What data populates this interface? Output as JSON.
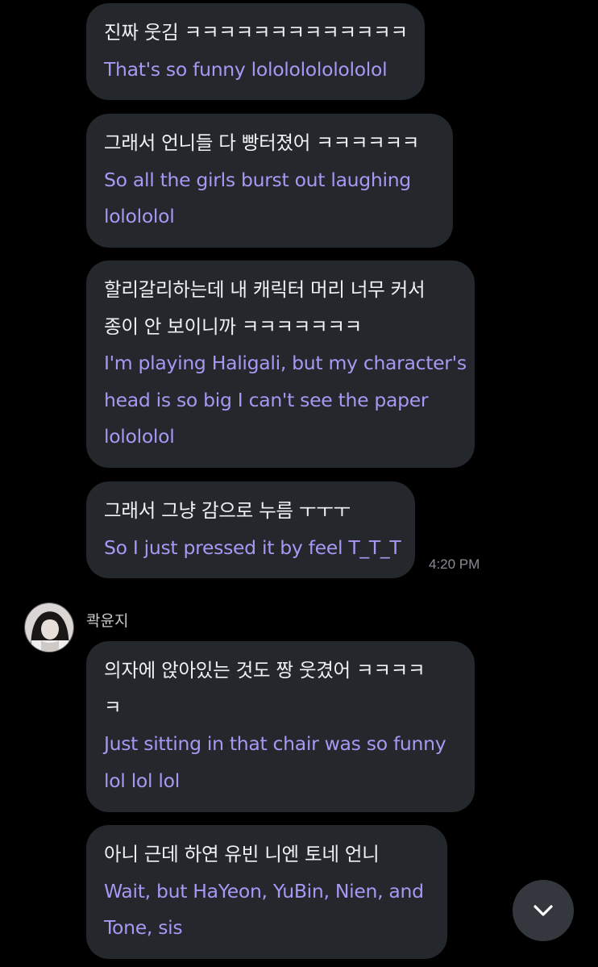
{
  "messages": [
    {
      "ko": [
        "진짜 웃김 ㅋㅋㅋㅋㅋㅋㅋㅋㅋㅋㅋㅋㅋ"
      ],
      "en": [
        "That's so funny lolololololololol"
      ]
    },
    {
      "ko": [
        "그래서 언니들 다 빵터졌어 ㅋㅋㅋㅋㅋㅋ"
      ],
      "en": [
        "So all the girls burst out laughing",
        "lolololol"
      ]
    },
    {
      "ko": [
        "할리갈리하는데 내 캐릭터 머리 너무 커서",
        "종이 안 보이니까 ㅋㅋㅋㅋㅋㅋㅋ"
      ],
      "en": [
        "I'm playing Haligali, but my character's",
        "head is so big I can't see the paper",
        "lolololol"
      ]
    },
    {
      "ko": [
        "그래서 그냥 감으로 누름 ㅜㅜㅜ"
      ],
      "en": [
        "So I just pressed it by feel T_T_T"
      ]
    },
    {
      "ko": [
        "의자에 앉아있는 것도 짱 웃겼어 ㅋㅋㅋㅋ",
        "ㅋ"
      ],
      "en": [
        "Just sitting in that chair was so funny",
        "lol lol lol"
      ]
    },
    {
      "ko": [
        "아니 근데 하연 유빈 니엔 토네 언니"
      ],
      "en": [
        "Wait, but HaYeon, YuBin, Nien, and",
        "Tone, sis"
      ]
    }
  ],
  "timestamp": "4:20 PM",
  "sender": {
    "name": "콱윤지",
    "avatar_icon": "profile-photo"
  },
  "scroll_down_icon": "chevron-down-icon",
  "colors": {
    "background": "#000000",
    "bubble": "#24272c",
    "original_text": "#f1f1f3",
    "translated_text": "#a898f4",
    "timestamp": "#8a8c93"
  }
}
